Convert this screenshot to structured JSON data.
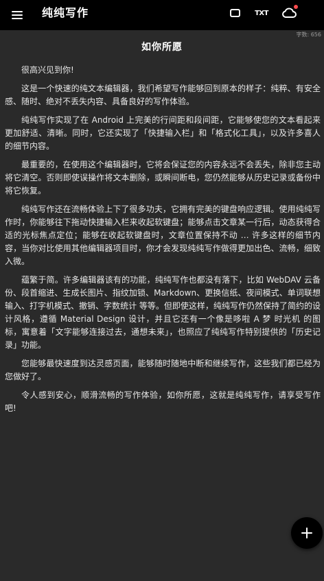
{
  "appbar": {
    "title": "纯纯写作",
    "icons": [
      "menu-icon",
      "box-icon",
      "txt-icon",
      "cloud-sync-icon"
    ],
    "txt_label": "TXT",
    "sync_badge_color": "#ff4d4f"
  },
  "document": {
    "word_count": "字数: 656",
    "title": "如你所愿",
    "paragraphs": [
      "很高兴见到你!",
      "这是一个快速的纯文本编辑器，我们希望写作能够回到原本的样子：纯粹、有安全感、随时、绝对不丢失内容、具备良好的写作体验。",
      "纯纯写作实现了在 Android 上完美的行间距和段间距，它能够使您的文本看起来更加舒适、清晰。同时，它还实现了「快捷输入栏」和「格式化工具」，以及许多喜人的细节内容。",
      "最重要的，在使用这个编辑器时，它将会保证您的内容永远不会丢失，除非您主动将它清空。否则即使误操作将文本删除，或瞬间断电，您仍然能够从历史记录或备份中将它恢复。",
      "纯纯写作还在流畅体验上下了很多功夫，它拥有完美的键盘响应逻辑。使用纯纯写作时，你能够往下拖动快捷输入栏来收起软键盘；能够点击文章某一行后，动态获得合适的光标焦点定位；能够在收起软键盘时，文章位置保持不动 … 许多这样的细节内容，当你对比使用其他编辑器项目时，你才会发现纯纯写作做得更加出色、流畅，细致入微。",
      "蕴繁于简。许多编辑器该有的功能，纯纯写作也都没有落下，比如 WebDAV 云备份、段首缩进、生成长图片、指纹加锁、Markdown、更换信纸、夜间模式、单词联想输入、打字机模式、撤销、字数统计 等等。但即使这样，纯纯写作仍然保持了简约的设计风格，遵循 Material Design 设计，并且它还有一个像是哆啦 A 梦 时光机 的图标，寓意着「文字能够连接过去，通想未来」，也照应了纯纯写作特别提供的「历史记录」功能。",
      "您能够最快速度到达灵感页面，能够随时随地中断和继续写作，这些我们都已经为您做好了。",
      "令人感到安心，顺滑流畅的写作体验，如你所愿，这就是纯纯写作，请享受写作吧!"
    ]
  },
  "fab": {
    "icon": "plus-icon",
    "background": "#000000"
  },
  "colors": {
    "appbar_bg": "#000000",
    "page_bg": "#2a2a2a",
    "text": "#e8e8e8",
    "title": "#ffffff",
    "muted": "#9a9a9a"
  }
}
